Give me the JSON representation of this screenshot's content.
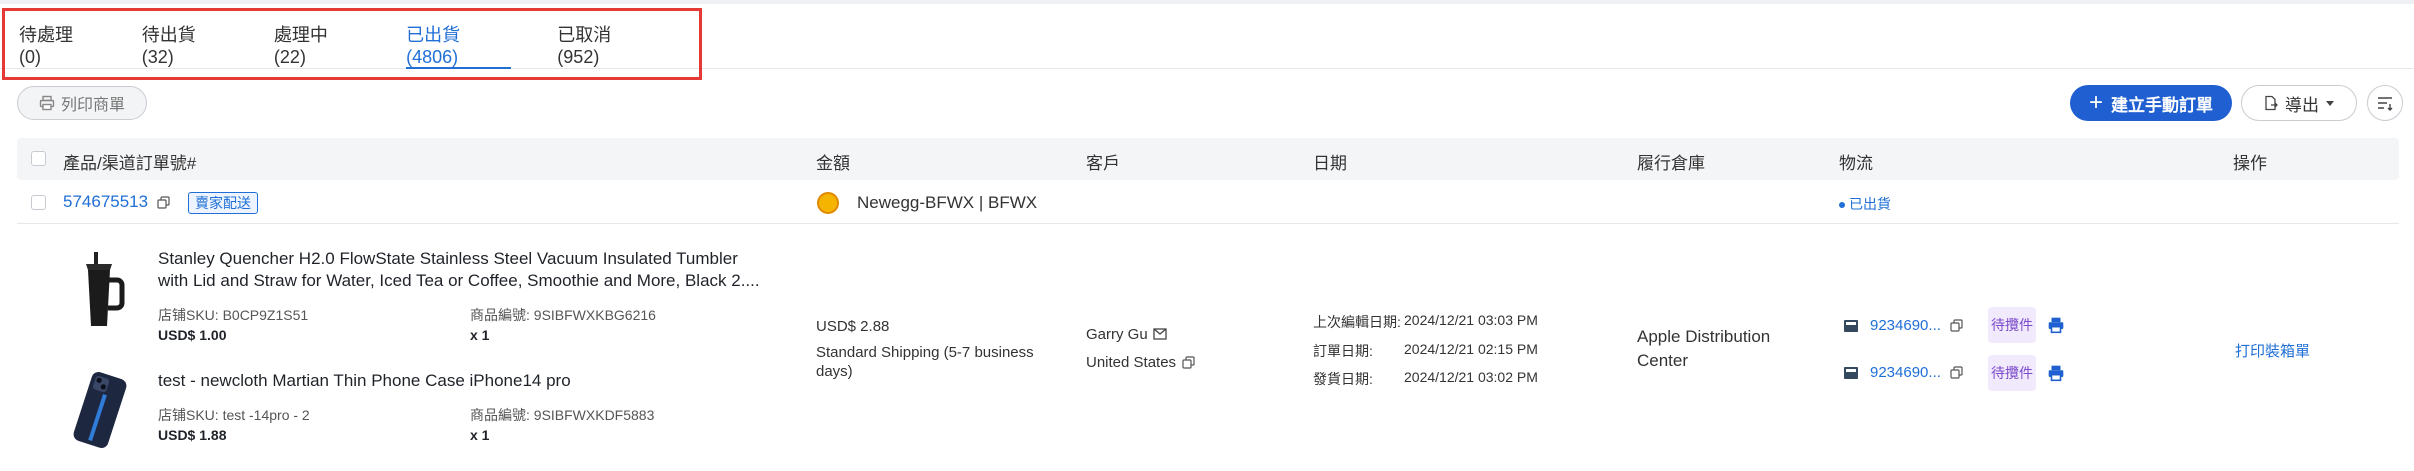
{
  "tabs": [
    {
      "label": "待處理 (0)"
    },
    {
      "label": "待出貨 (32)"
    },
    {
      "label": "處理中 (22)"
    },
    {
      "label": "已出貨 (4806)",
      "active": true
    },
    {
      "label": "已取消 (952)"
    }
  ],
  "toolbar": {
    "print_label": "列印商單",
    "create_label": "建立手動訂單",
    "export_label": "導出"
  },
  "columns": [
    "產品/渠道訂單號#",
    "金額",
    "客戶",
    "日期",
    "履行倉庫",
    "物流",
    "操作"
  ],
  "order": {
    "number": "574675513",
    "delivery_badge": "賣家配送",
    "store": "Newegg-BFWX | BFWX",
    "status": "已出貨",
    "amount": "USD$ 2.88",
    "shipping": "Standard Shipping (5-7 business days)",
    "customer": "Garry Gu",
    "country": "United States",
    "date_labels": [
      "上次編輯日期:",
      "訂單日期:",
      "發貨日期:"
    ],
    "date_values": [
      "2024/12/21 03:03 PM",
      "2024/12/21 02:15 PM",
      "2024/12/21 03:02 PM"
    ],
    "warehouse": "Apple Distribution Center",
    "tracking": [
      {
        "number": "9234690...",
        "status": "待攬件"
      },
      {
        "number": "9234690...",
        "status": "待攬件"
      }
    ],
    "action": "打印裝箱單",
    "products": [
      {
        "title": "Stanley Quencher H2.0 FlowState Stainless Steel Vacuum Insulated Tumbler with Lid and Straw for Water, Iced Tea or Coffee, Smoothie and More, Black 2....",
        "store_sku": "店铺SKU: B0CP9Z1S51",
        "product_code": "商品編號: 9SIBFWXKBG6216",
        "price": "USD$ 1.00",
        "qty": "x 1"
      },
      {
        "title": "test - newcloth Martian Thin Phone Case iPhone14 pro",
        "store_sku": "店铺SKU: test -14pro - 2",
        "product_code": "商品編號: 9SIBFWXKDF5883",
        "price": "USD$ 1.88",
        "qty": "x 1"
      }
    ]
  },
  "colors": {
    "accent": "#1f5fd1",
    "link": "#1f6fd6",
    "highlight_border": "#e53935",
    "pending_bg": "#f1eafd"
  }
}
